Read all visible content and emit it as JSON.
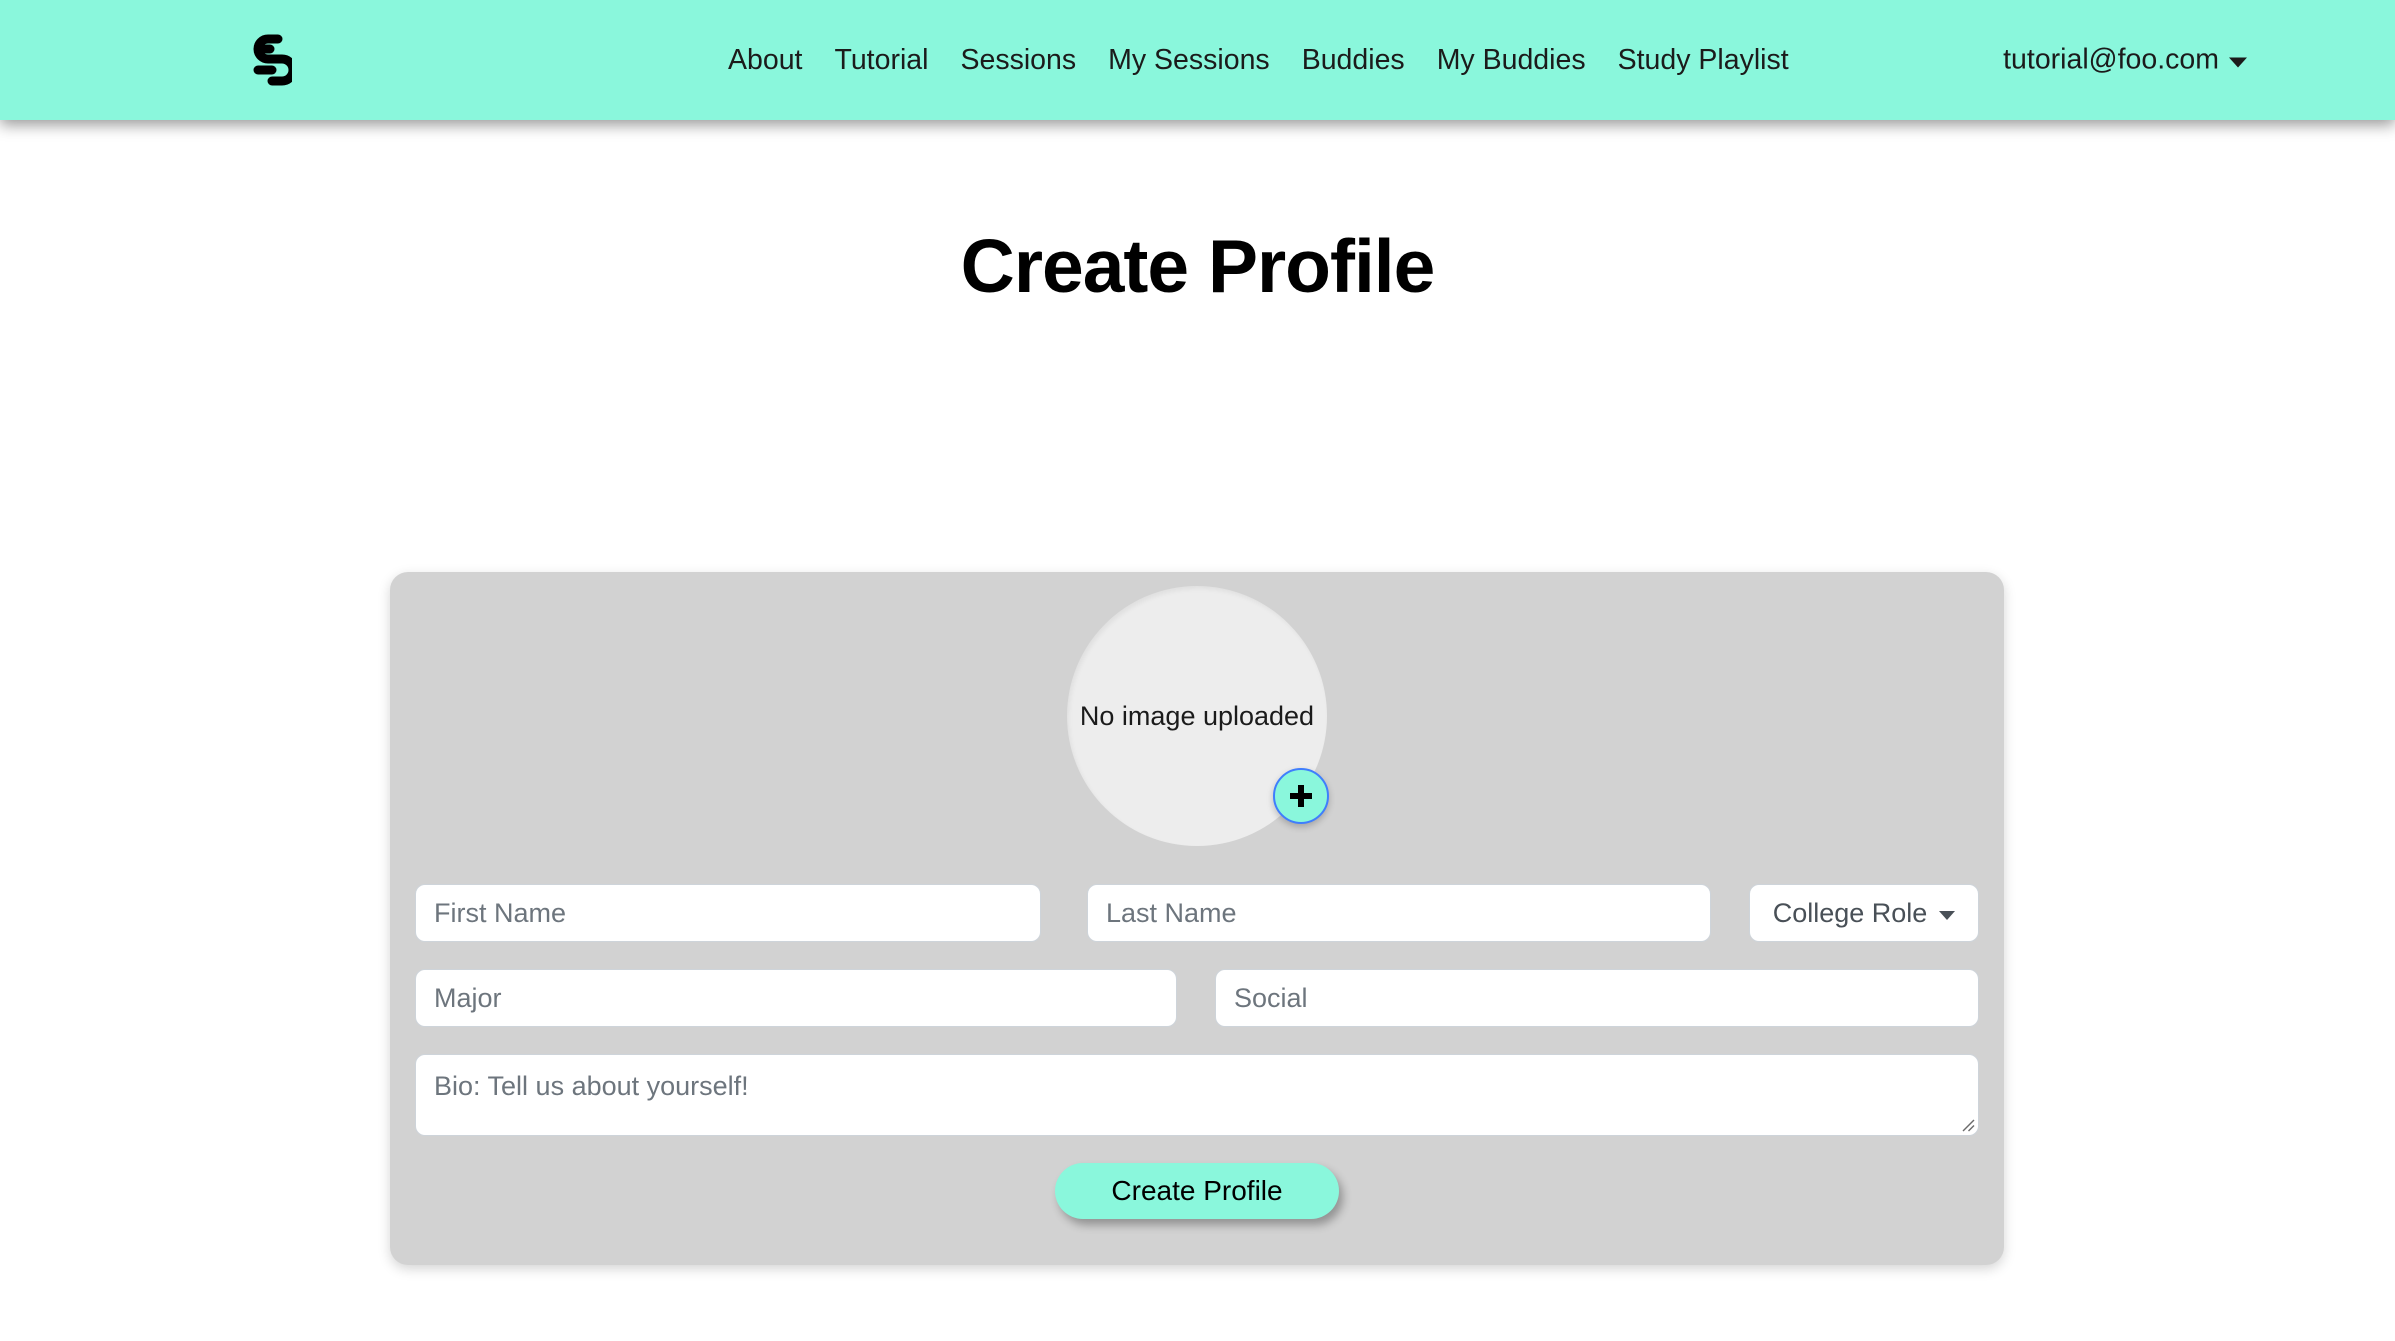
{
  "navbar": {
    "brand_icon": "studybuddy-logo-icon",
    "links": [
      {
        "label": "About"
      },
      {
        "label": "Tutorial"
      },
      {
        "label": "Sessions"
      },
      {
        "label": "My Sessions"
      },
      {
        "label": "Buddies"
      },
      {
        "label": "My Buddies"
      },
      {
        "label": "Study Playlist"
      }
    ],
    "user": {
      "email": "tutorial@foo.com",
      "caret_icon": "chevron-down-icon"
    },
    "background_color": "#8af7dc"
  },
  "page": {
    "title": "Create Profile"
  },
  "profile_form": {
    "avatar": {
      "placeholder_text": "No image uploaded",
      "add_button_icon": "plus-icon",
      "add_button_color": "#8af7dc",
      "add_button_ring_color": "#3f7efd"
    },
    "fields": {
      "first_name": {
        "value": "",
        "placeholder": "First Name"
      },
      "last_name": {
        "value": "",
        "placeholder": "Last Name"
      },
      "college_role": {
        "selected": "College Role",
        "caret_icon": "chevron-down-icon"
      },
      "major": {
        "value": "",
        "placeholder": "Major"
      },
      "social": {
        "value": "",
        "placeholder": "Social"
      },
      "bio": {
        "value": "",
        "placeholder": "Bio: Tell us about yourself!"
      }
    },
    "submit_label": "Create Profile",
    "card_color": "#d2d2d2",
    "accent_color": "#8af7dc"
  }
}
